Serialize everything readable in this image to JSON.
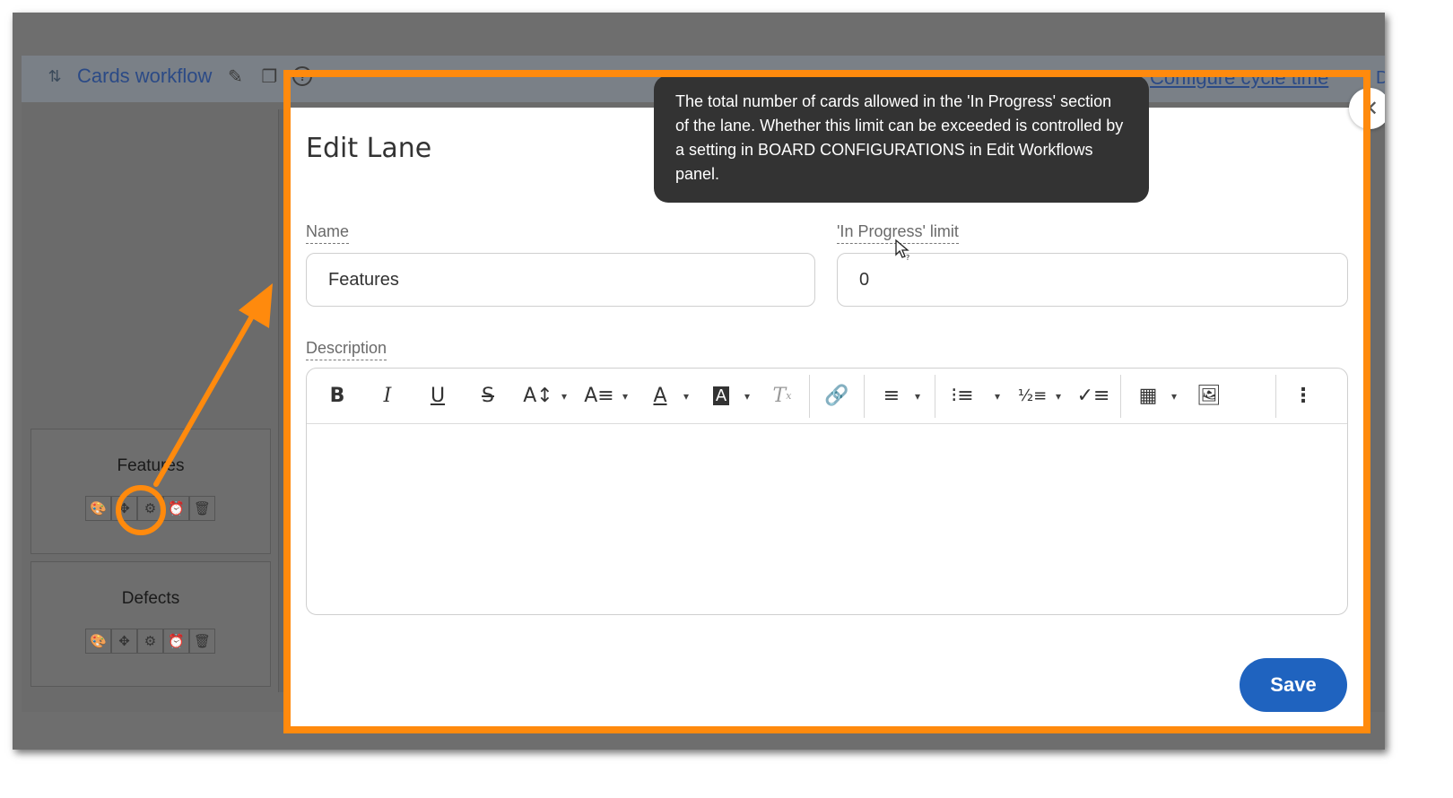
{
  "board": {
    "title": "Cards workflow",
    "configure_link": "Configure cycle time",
    "peek_right": "De",
    "lanes": [
      {
        "name": "Features"
      },
      {
        "name": "Defects"
      }
    ]
  },
  "modal": {
    "title": "Edit Lane",
    "close_symbol": "✕",
    "name_label": "Name",
    "name_value": "Features",
    "limit_label": "'In Progress' limit",
    "limit_value": "0",
    "description_label": "Description",
    "save_label": "Save"
  },
  "tooltip": {
    "text": "The total number of cards allowed in the 'In Progress' section of the lane. Whether this limit can be exceeded is controlled by a setting in BOARD CONFIGURATIONS in Edit Workflows panel."
  },
  "colors": {
    "accent_orange": "#ff8a0d",
    "save_blue": "#1f63bf",
    "link_blue": "#2b4a86",
    "tooltip_bg": "#333333"
  },
  "icons": {
    "lane_tools": [
      "palette-icon",
      "move-icon",
      "gear-icon",
      "alarm-icon",
      "trash-icon"
    ],
    "editor_toolbar": [
      "bold-icon",
      "italic-icon",
      "underline-icon",
      "strikethrough-icon",
      "font-size-icon",
      "font-family-icon",
      "text-color-icon",
      "highlight-color-icon",
      "clear-format-icon",
      "link-icon",
      "align-icon",
      "bullet-list-icon",
      "numbered-list-icon",
      "checklist-icon",
      "table-icon",
      "image-icon",
      "more-icon"
    ]
  }
}
